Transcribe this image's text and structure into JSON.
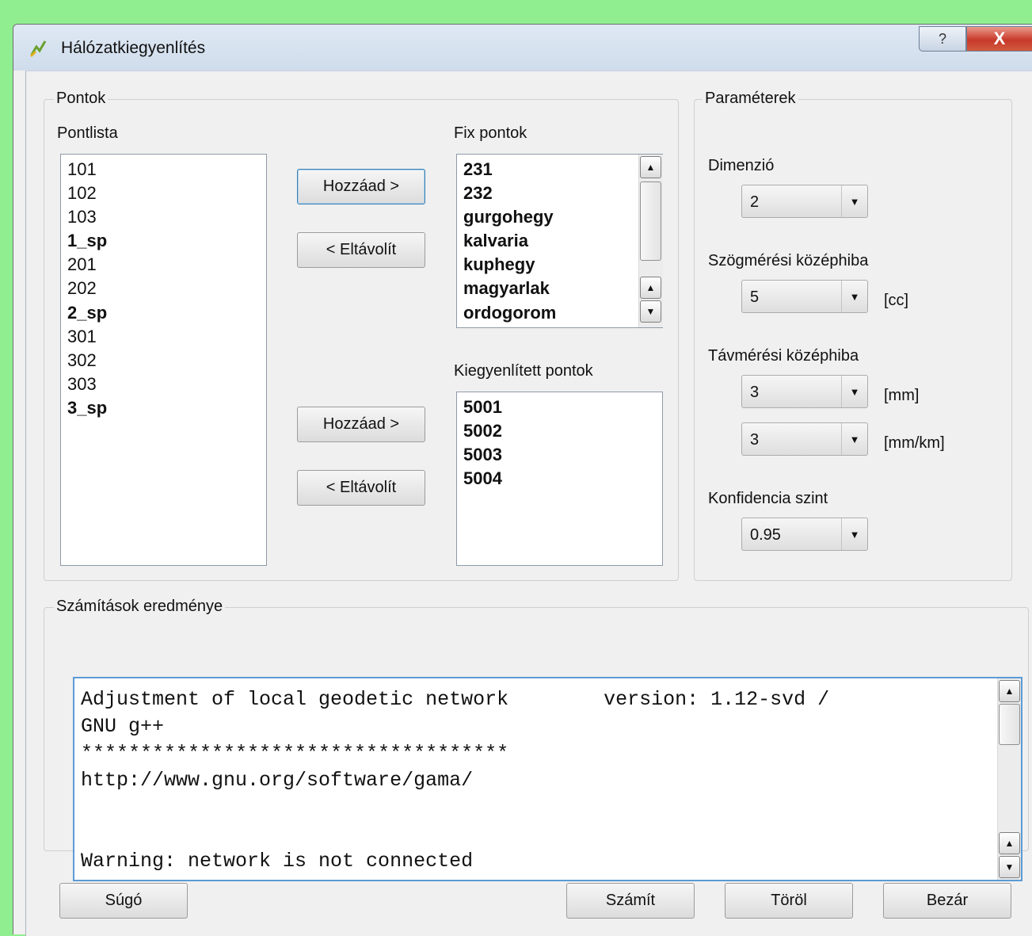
{
  "window": {
    "title": "Hálózatkiegyenlítés",
    "help_glyph": "?",
    "close_glyph": "X"
  },
  "points_group": {
    "legend": "Pontok",
    "pointlist_label": "Pontlista",
    "pointlist": [
      {
        "text": "101",
        "bold": false
      },
      {
        "text": "102",
        "bold": false
      },
      {
        "text": "103",
        "bold": false
      },
      {
        "text": "1_sp",
        "bold": true
      },
      {
        "text": "201",
        "bold": false
      },
      {
        "text": "202",
        "bold": false
      },
      {
        "text": "2_sp",
        "bold": true
      },
      {
        "text": "301",
        "bold": false
      },
      {
        "text": "302",
        "bold": false
      },
      {
        "text": "303",
        "bold": false
      },
      {
        "text": "3_sp",
        "bold": true
      }
    ],
    "fixed_label": "Fix pontok",
    "fixed": [
      "231",
      "232",
      "gurgohegy",
      "kalvaria",
      "kuphegy",
      "magyarlak",
      "ordogorom"
    ],
    "adjusted_label": "Kiegyenlített pontok",
    "adjusted": [
      "5001",
      "5002",
      "5003",
      "5004"
    ],
    "add_fixed_label": "Hozzáad >",
    "remove_fixed_label": "< Eltávolít",
    "add_adjusted_label": "Hozzáad >",
    "remove_adjusted_label": "< Eltávolít"
  },
  "params_group": {
    "legend": "Paraméterek",
    "dimension_label": "Dimenzió",
    "dimension_value": "2",
    "angle_label": "Szögmérési középhiba",
    "angle_value": "5",
    "angle_unit": "[cc]",
    "distance_label": "Távmérési középhiba",
    "distance_value1": "3",
    "distance_unit1": "[mm]",
    "distance_value2": "3",
    "distance_unit2": "[mm/km]",
    "confidence_label": "Konfidencia szint",
    "confidence_value": "0.95"
  },
  "results": {
    "legend": "Számítások eredménye",
    "text": "Adjustment of local geodetic network        version: 1.12-svd /\nGNU g++\n************************************\nhttp://www.gnu.org/software/gama/\n\n\nWarning: network is not connected"
  },
  "footer": {
    "help_label": "Súgó",
    "compute_label": "Számít",
    "clear_label": "Töröl",
    "close_label": "Bezár"
  },
  "colors": {
    "background": "#90ee90",
    "focus_border": "#5b9bd5",
    "close_button": "#c8392a"
  }
}
